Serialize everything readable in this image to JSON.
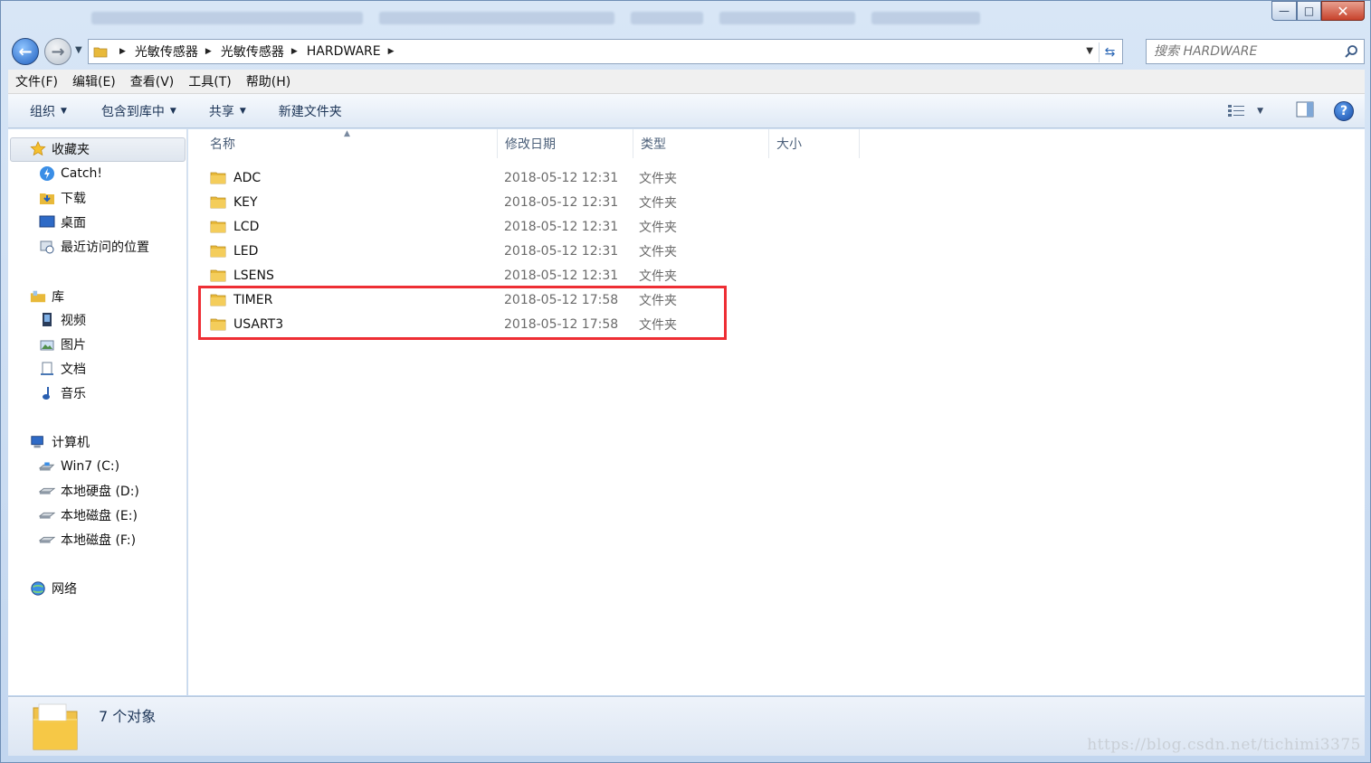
{
  "address": {
    "breadcrumbs": [
      "光敏传感器",
      "光敏传感器",
      "HARDWARE"
    ]
  },
  "search": {
    "placeholder": "搜索 HARDWARE"
  },
  "menu": [
    "文件(F)",
    "编辑(E)",
    "查看(V)",
    "工具(T)",
    "帮助(H)"
  ],
  "toolbar": {
    "organize": "组织",
    "include_library": "包含到库中",
    "share": "共享",
    "new_folder": "新建文件夹"
  },
  "nav": {
    "favorites": {
      "title": "收藏夹",
      "items": [
        "Catch!",
        "下载",
        "桌面",
        "最近访问的位置"
      ]
    },
    "libraries": {
      "title": "库",
      "items": [
        "视频",
        "图片",
        "文档",
        "音乐"
      ]
    },
    "computer": {
      "title": "计算机",
      "items": [
        "Win7 (C:)",
        "本地硬盘 (D:)",
        "本地磁盘 (E:)",
        "本地磁盘 (F:)"
      ]
    },
    "network": {
      "title": "网络"
    }
  },
  "columns": [
    "名称",
    "修改日期",
    "类型",
    "大小"
  ],
  "files": [
    {
      "name": "ADC",
      "date": "2018-05-12 12:31",
      "type": "文件夹"
    },
    {
      "name": "KEY",
      "date": "2018-05-12 12:31",
      "type": "文件夹"
    },
    {
      "name": "LCD",
      "date": "2018-05-12 12:31",
      "type": "文件夹"
    },
    {
      "name": "LED",
      "date": "2018-05-12 12:31",
      "type": "文件夹"
    },
    {
      "name": "LSENS",
      "date": "2018-05-12 12:31",
      "type": "文件夹"
    },
    {
      "name": "TIMER",
      "date": "2018-05-12 17:58",
      "type": "文件夹"
    },
    {
      "name": "USART3",
      "date": "2018-05-12 17:58",
      "type": "文件夹"
    }
  ],
  "status": {
    "count": "7 个对象"
  },
  "watermark": "https://blog.csdn.net/tichimi3375",
  "colors": {
    "highlight": "#ee2e34",
    "folder": "#f0c24a",
    "accent": "#1f5fbf"
  }
}
